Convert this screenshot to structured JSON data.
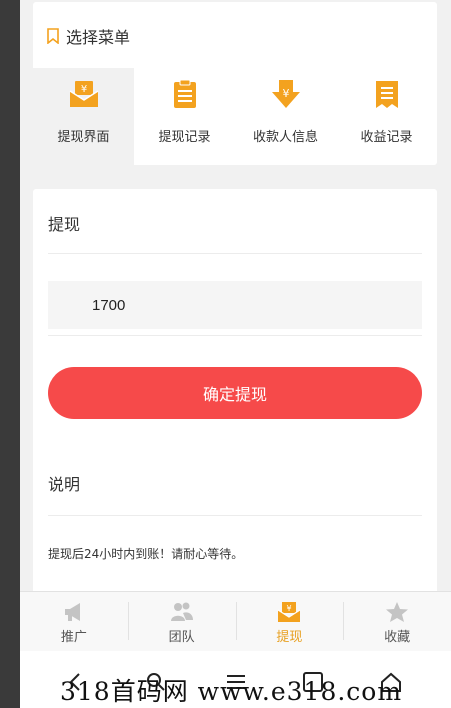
{
  "menu": {
    "title": "选择菜单",
    "items": [
      {
        "label": "提现界面",
        "icon": "withdraw-envelope-icon",
        "active": true
      },
      {
        "label": "提现记录",
        "icon": "clipboard-icon",
        "active": false
      },
      {
        "label": "收款人信息",
        "icon": "download-yuan-icon",
        "active": false
      },
      {
        "label": "收益记录",
        "icon": "document-list-icon",
        "active": false
      }
    ]
  },
  "withdraw": {
    "title": "提现",
    "amount_value": "1700",
    "confirm_label": "确定提现",
    "note_title": "说明",
    "note_text": "提现后24小时内到账！请耐心等待。"
  },
  "tabs": [
    {
      "label": "推广",
      "icon": "megaphone-icon"
    },
    {
      "label": "团队",
      "icon": "team-icon"
    },
    {
      "label": "提现",
      "icon": "withdraw-icon"
    },
    {
      "label": "收藏",
      "icon": "star-icon"
    }
  ],
  "watermark": "318首码网 www.e318.com",
  "colors": {
    "accent_orange": "#f3a21f",
    "confirm_red": "#f64a4a",
    "active_tab": "#e8a020",
    "inactive_icon": "#c4c4c4"
  }
}
